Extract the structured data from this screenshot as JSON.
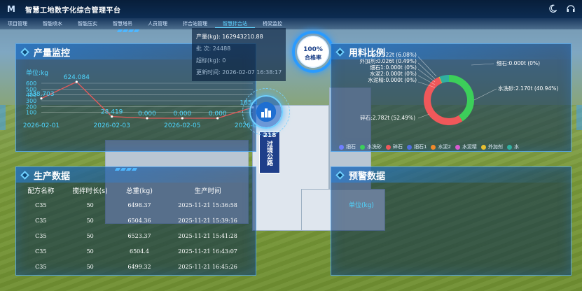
{
  "app": {
    "title": "智慧工地数字化综合管理平台",
    "logo": "M"
  },
  "header_icons": [
    "moon-icon",
    "headset-icon"
  ],
  "nav": {
    "items": [
      "项目管理",
      "智能喷水",
      "智能压实",
      "智慧塔吊",
      "人员管理",
      "拌合站管理",
      "智慧拌合站",
      "桥梁监控"
    ],
    "active_index": 6
  },
  "production_monitor": {
    "title": "产量监控",
    "unit": "单位:kg"
  },
  "material_ratio": {
    "title": "用料比例"
  },
  "production_data": {
    "title": "生产数据",
    "columns": [
      "配方名称",
      "搅拌时长(s)",
      "总重(kg)",
      "生产时间"
    ],
    "rows": [
      [
        "C35",
        "50",
        "6498.37",
        "2025-11-21 15:36:58"
      ],
      [
        "C35",
        "50",
        "6504.36",
        "2025-11-21 15:39:16"
      ],
      [
        "C35",
        "50",
        "6523.37",
        "2025-11-21 15:41:28"
      ],
      [
        "C35",
        "50",
        "6504.4",
        "2025-11-21 16:43:07"
      ],
      [
        "C35",
        "50",
        "6499.32",
        "2025-11-21 16:45:26"
      ]
    ]
  },
  "warning_data": {
    "title": "预警数据",
    "unit": "单位(kg)"
  },
  "info_box": {
    "output_label": "产量(kg):",
    "output_value": "162943210.88",
    "batch_label": "批    次:",
    "batch_value": "24488",
    "overweight_label": "超标(kg):",
    "overweight_value": "0",
    "updated_label": "更新时间:",
    "updated_value": "2026-02-07 16:38:17"
  },
  "gauge": {
    "value": "100%",
    "label": "合格率"
  },
  "scene_text": {
    "sign_number": "218",
    "sign_text": "过境公路"
  },
  "chart_data": [
    {
      "type": "line",
      "title": "产量监控",
      "ylabel": "单位:kg",
      "x": [
        "2026-02-01",
        "2026-02-02",
        "2026-02-03",
        "2026-02-04",
        "2026-02-05",
        "2026-02-06",
        "2026-02-07"
      ],
      "x_tick_labels": [
        "2026-02-01",
        "2026-02-03",
        "2026-02-05",
        "2026-02-07"
      ],
      "series": [
        {
          "values": [
            338.703,
            624.084,
            28.419,
            0.0,
            0.0,
            0.0,
            185.422
          ]
        }
      ],
      "data_labels": [
        "338.703",
        "624.084",
        "28.419",
        "0.000",
        "0.000",
        "0.000",
        "185.422"
      ],
      "yticks": [
        100,
        200,
        300,
        400,
        500,
        600
      ],
      "ylim": [
        0,
        700
      ],
      "grid": true,
      "color": "#e85a5a"
    },
    {
      "type": "pie",
      "title": "用料比例",
      "donut": true,
      "slices": [
        {
          "name": "细石",
          "value": 0.0,
          "label": "细石:0.000t (0%)",
          "color": "#6f7fff"
        },
        {
          "name": "水洗砂",
          "value": 2.17,
          "label": "水洗砂:2.170t (40.94%)",
          "color": "#3ccf5a"
        },
        {
          "name": "碎石",
          "value": 2.782,
          "label": "碎石:2.782t (52.49%)",
          "color": "#f0585a"
        },
        {
          "name": "细石1",
          "value": 0.0,
          "label": "细石1:0.000t (0%)",
          "color": "#4f6fe0"
        },
        {
          "name": "水泥2",
          "value": 0.0,
          "label": "水泥2:0.000t (0%)",
          "color": "#f08a2a"
        },
        {
          "name": "水泥精",
          "value": 0.0,
          "label": "水泥精:0.000t (0%)",
          "color": "#d85ad0"
        },
        {
          "name": "外加剂",
          "value": 0.026,
          "label": "外加剂:0.026t (0.49%)",
          "color": "#e8c030"
        },
        {
          "name": "水",
          "value": 0.322,
          "label": "水:0.322t (6.08%)",
          "color": "#30b0a0"
        }
      ]
    }
  ],
  "colors": {
    "accent": "#4fd6ff",
    "panel_border": "#5ab4ff",
    "line": "#e85a5a"
  }
}
